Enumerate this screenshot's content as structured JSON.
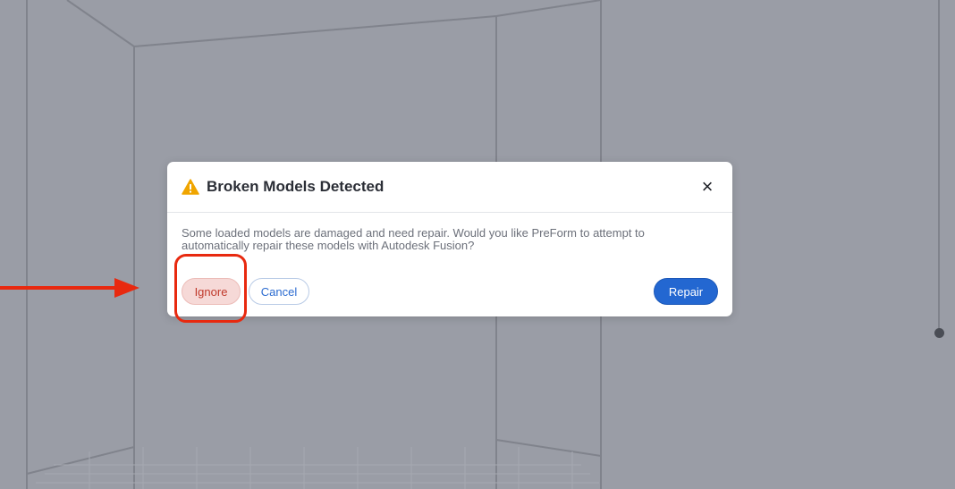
{
  "dialog": {
    "title": "Broken Models Detected",
    "message": "Some loaded models are damaged and need repair. Would you like PreForm to attempt to automatically repair these models with Autodesk Fusion?",
    "close_symbol": "×",
    "buttons": {
      "ignore": "Ignore",
      "cancel": "Cancel",
      "repair": "Repair"
    }
  },
  "icons": {
    "warning": "warning-triangle-icon",
    "close": "close-icon"
  },
  "colors": {
    "accent": "#2367d1",
    "danger": "#c0392b",
    "warning": "#f0a500",
    "annotation": "#e8290f",
    "background": "#9a9da6"
  }
}
